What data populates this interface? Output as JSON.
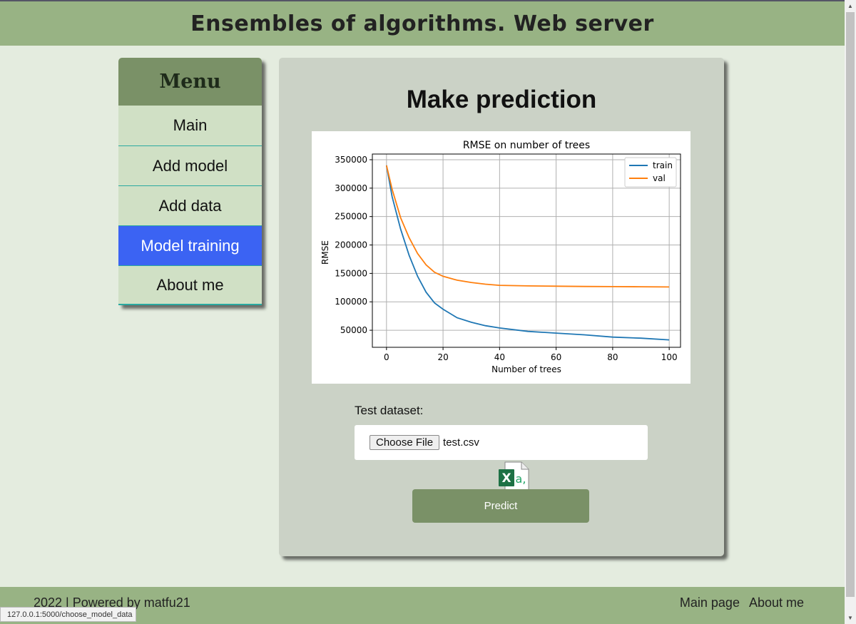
{
  "header": {
    "title": "Ensembles of algorithms. Web server"
  },
  "menu": {
    "title": "Menu",
    "items": [
      {
        "label": "Main"
      },
      {
        "label": "Add model"
      },
      {
        "label": "Add data"
      },
      {
        "label": "Model training",
        "active": true
      },
      {
        "label": "About me"
      }
    ]
  },
  "main": {
    "title": "Make prediction",
    "test_label": "Test dataset:",
    "choose_file_label": "Choose File",
    "file_name": "test.csv",
    "predict_label": "Predict",
    "file_icon": "excel-csv-file-icon"
  },
  "chart_data": {
    "type": "line",
    "title": "RMSE on number of trees",
    "xlabel": "Number of trees",
    "ylabel": "RMSE",
    "xlim": [
      -5,
      104
    ],
    "ylim": [
      20000,
      360000
    ],
    "xticks": [
      0,
      20,
      40,
      60,
      80,
      100
    ],
    "yticks": [
      50000,
      100000,
      150000,
      200000,
      250000,
      300000,
      350000
    ],
    "grid": true,
    "legend": "top-right",
    "series": [
      {
        "name": "train",
        "color": "#1f77b4",
        "x": [
          0,
          2,
          5,
          8,
          11,
          14,
          17,
          20,
          25,
          30,
          35,
          40,
          50,
          60,
          70,
          80,
          90,
          100
        ],
        "y": [
          340000,
          285000,
          228000,
          182000,
          145000,
          117000,
          98000,
          87000,
          72000,
          64000,
          58000,
          54000,
          48000,
          45000,
          42000,
          38000,
          36000,
          33000
        ]
      },
      {
        "name": "val",
        "color": "#ff7f0e",
        "x": [
          0,
          2,
          5,
          8,
          11,
          14,
          17,
          20,
          25,
          30,
          35,
          40,
          50,
          60,
          70,
          80,
          90,
          100
        ],
        "y": [
          340000,
          298000,
          248000,
          213000,
          185000,
          165000,
          152000,
          145000,
          138000,
          134000,
          131000,
          129000,
          128000,
          127500,
          127000,
          126800,
          126500,
          126200
        ]
      }
    ]
  },
  "footer": {
    "copyright": "2022 | Powered by matfu21",
    "links": [
      "Main page",
      "About me"
    ]
  },
  "status_bar": {
    "url": "127.0.0.1:5000/choose_model_data"
  }
}
